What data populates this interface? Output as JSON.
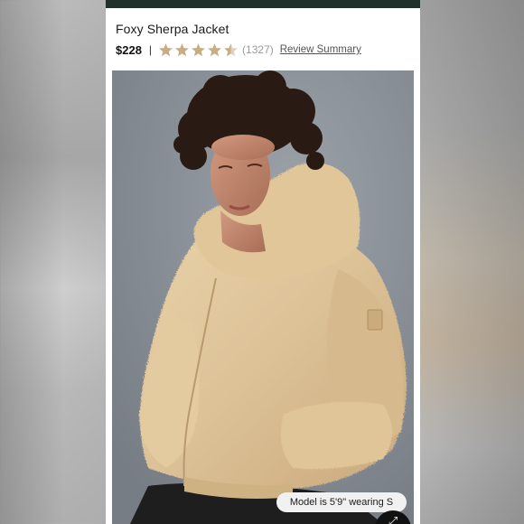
{
  "product": {
    "title": "Foxy Sherpa Jacket",
    "price": "$228",
    "separator": "|",
    "rating": 4.5,
    "review_count": "(1327)",
    "review_summary_label": "Review Summary"
  },
  "image": {
    "model_info": "Model is 5'9\" wearing S"
  },
  "colors": {
    "top_bar": "#20302a",
    "star_fill": "#c8ad84",
    "star_empty": "#ddd2c2",
    "link": "#555555"
  },
  "icons": {
    "star": "star-icon",
    "zoom": "zoom-icon"
  }
}
